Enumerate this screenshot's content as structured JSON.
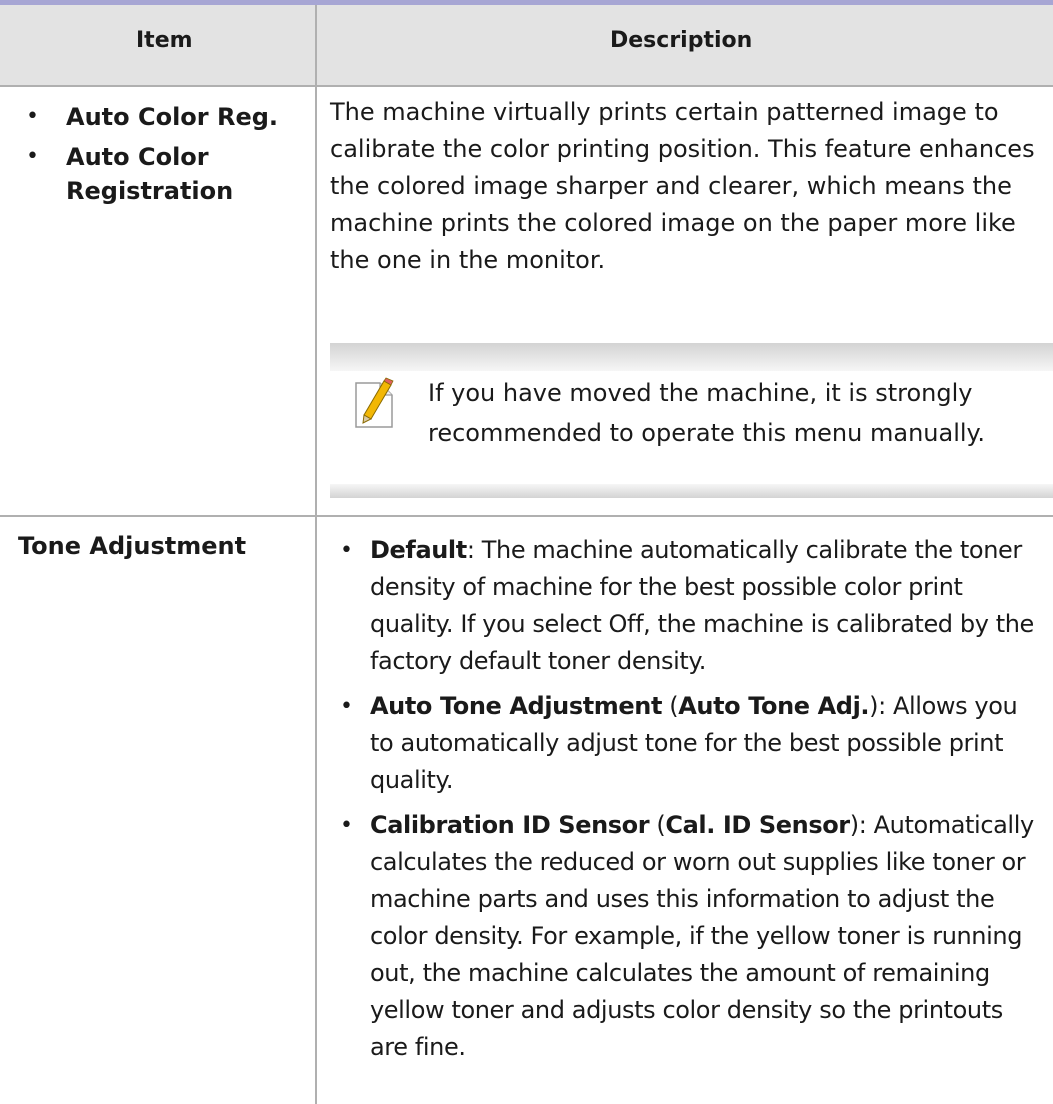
{
  "header": {
    "item": "Item",
    "description": "Description"
  },
  "row1": {
    "items": [
      {
        "label": "Auto Color Reg."
      },
      {
        "label": "Auto Color Registration"
      }
    ],
    "description": "The machine virtually prints certain patterned image to calibrate the color printing position. This feature enhances the colored image sharper and clearer, which means the machine prints the colored image on the paper more like the one in the monitor.",
    "note": {
      "icon": "note-pencil-icon",
      "text": "If you have moved the machine, it is strongly recommended to operate this menu manually."
    }
  },
  "row2": {
    "item": "Tone Adjustment",
    "entries": [
      {
        "term": "Default",
        "separator": ": ",
        "alt": "",
        "text": "The machine automatically calibrate the toner density of machine for the best possible color print quality. If you select Off, the machine is calibrated by the factory default toner density."
      },
      {
        "term": "Auto Tone Adjustment",
        "alt": "Auto Tone Adj.",
        "text": "Allows you to automatically adjust tone for the best possible print quality."
      },
      {
        "term": "Calibration ID Sensor",
        "alt": "Cal. ID Sensor",
        "text": "Automatically calculates the reduced or worn out supplies like toner or machine parts and uses this information to adjust the color density. For example, if the yellow toner is running out, the machine calculates the amount of remaining yellow toner and adjusts color density so the printouts are fine."
      }
    ]
  },
  "colors": {
    "top_rule": "#a7a6d4",
    "header_bg": "#e3e3e3",
    "rules": "#b0b0b0"
  }
}
